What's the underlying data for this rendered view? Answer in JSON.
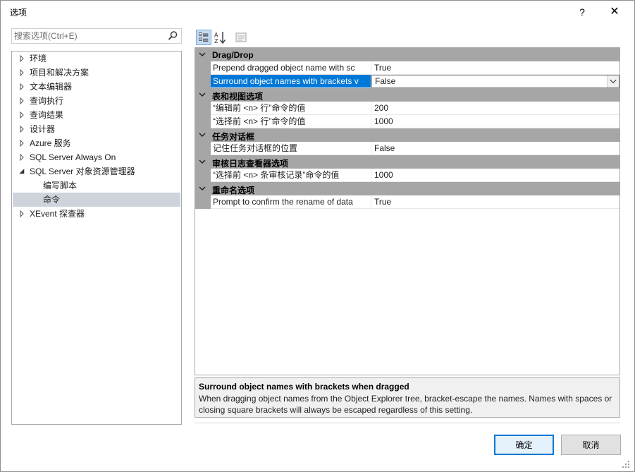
{
  "window": {
    "title": "选项",
    "help_glyph": "?",
    "close_glyph": "✕"
  },
  "search": {
    "placeholder": "搜索选项(Ctrl+E)",
    "value": "",
    "icon": "search-icon"
  },
  "tree": {
    "items": [
      {
        "label": "环境",
        "expanded": false
      },
      {
        "label": "项目和解决方案",
        "expanded": false
      },
      {
        "label": "文本编辑器",
        "expanded": false
      },
      {
        "label": "查询执行",
        "expanded": false
      },
      {
        "label": "查询结果",
        "expanded": false
      },
      {
        "label": "设计器",
        "expanded": false
      },
      {
        "label": "Azure 服务",
        "expanded": false
      },
      {
        "label": "SQL Server Always On",
        "expanded": false
      },
      {
        "label": "SQL Server 对象资源管理器",
        "expanded": true
      },
      {
        "label": "编写脚本",
        "child": true
      },
      {
        "label": "命令",
        "child": true,
        "selected": true
      },
      {
        "label": "XEvent 探查器",
        "expanded": false
      }
    ]
  },
  "toolbar": {
    "categorized_icon": "categorized-icon",
    "alphabetical_icon": "sort-alphabetical-icon",
    "pages_icon": "property-pages-icon"
  },
  "grid": {
    "categories": [
      {
        "label": "Drag/Drop",
        "rows": [
          {
            "name": "Prepend dragged object name with sc",
            "value": "True"
          },
          {
            "name": "Surround object names with brackets v",
            "value": "False",
            "selected": true
          }
        ]
      },
      {
        "label": "表和视图选项",
        "rows": [
          {
            "name": "“编辑前 <n> 行”命令的值",
            "value": "200"
          },
          {
            "name": "“选择前 <n> 行”命令的值",
            "value": "1000"
          }
        ]
      },
      {
        "label": "任务对话框",
        "rows": [
          {
            "name": "记住任务对话框的位置",
            "value": "False"
          }
        ]
      },
      {
        "label": "审核日志查看器选项",
        "rows": [
          {
            "name": "“选择前 <n> 条审核记录”命令的值",
            "value": "1000"
          }
        ]
      },
      {
        "label": "重命名选项",
        "rows": [
          {
            "name": "Prompt to confirm the rename of data",
            "value": "True"
          }
        ]
      }
    ]
  },
  "description": {
    "title": "Surround object names with brackets when dragged",
    "text": "When dragging object names from the Object Explorer tree, bracket-escape the names. Names with spaces or closing square brackets will always be escaped regardless of this setting."
  },
  "buttons": {
    "ok": "确定",
    "cancel": "取消"
  },
  "colors": {
    "accent": "#0078d7",
    "category_band": "#a6a6a6",
    "tree_selection": "#cfd3dc"
  }
}
